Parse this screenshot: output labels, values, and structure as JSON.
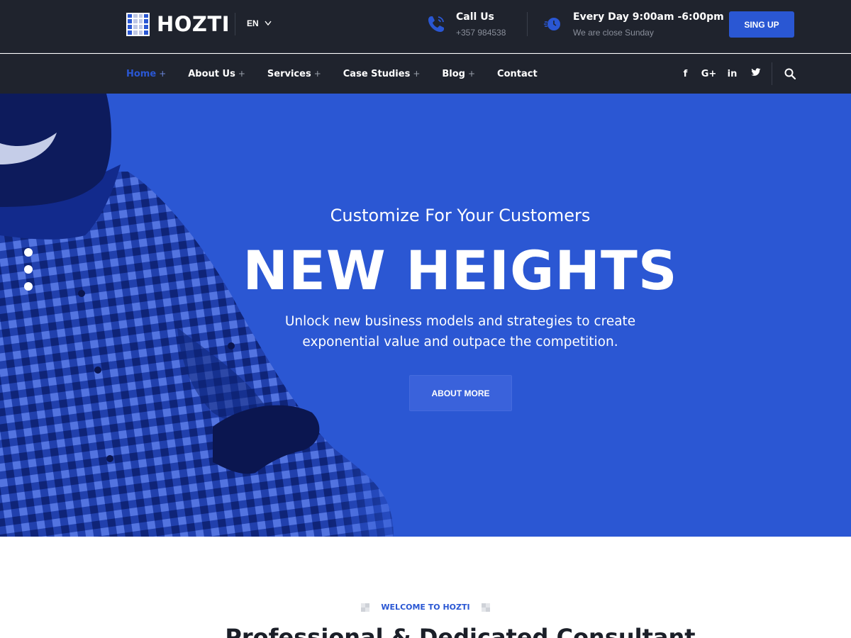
{
  "brand": {
    "name": "HOZTI",
    "language": "EN"
  },
  "contact": {
    "call_title": "Call Us",
    "call_number": "+357 984538",
    "hours_title": "Every Day 9:00am -6:00pm",
    "hours_note": "We are close Sunday"
  },
  "signup_label": "SING UP",
  "nav": {
    "items": [
      {
        "label": "Home",
        "plus": "+"
      },
      {
        "label": "About Us",
        "plus": "+"
      },
      {
        "label": "Services",
        "plus": "+"
      },
      {
        "label": "Case Studies",
        "plus": "+"
      },
      {
        "label": "Blog",
        "plus": "+"
      },
      {
        "label": "Contact",
        "plus": ""
      }
    ],
    "socials": [
      "f",
      "G+",
      "in",
      "twitter"
    ]
  },
  "hero": {
    "subtitle": "Customize For Your Customers",
    "title": "NEW HEIGHTS",
    "description": "Unlock new business models and strategies to create exponential value and outpace the competition.",
    "button_label": "ABOUT MORE",
    "slides": 3
  },
  "welcome": {
    "label": "WELCOME TO HOZTI",
    "title": "Professional & Dedicated Consultant"
  },
  "colors": {
    "accent": "#2a57d3",
    "header_bg": "#1f232d",
    "hero_bg": "#2b57d3"
  }
}
